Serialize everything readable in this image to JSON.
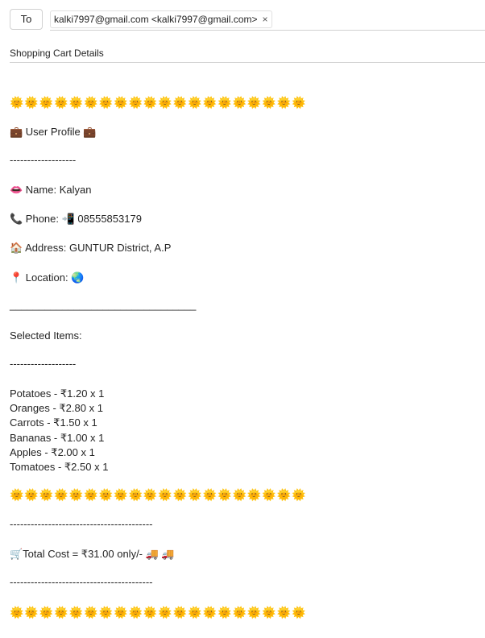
{
  "header": {
    "to_label": "To",
    "recipient": "kalki7997@gmail.com <kalki7997@gmail.com>",
    "remove_icon": "×",
    "subject": "Shopping Cart Details"
  },
  "body": {
    "sun_row": "🌞🌞🌞🌞🌞🌞🌞🌞🌞🌞🌞🌞🌞🌞🌞🌞🌞🌞🌞🌞",
    "profile_heading": "💼 User Profile 💼",
    "dash_short": "-------------------",
    "name_line": "👄 Name: Kalyan",
    "phone_line": "📞 Phone: 📲 08555853179",
    "address_line": "🏠 Address: GUNTUR District, A.P",
    "location_line": "📍 Location: 🌏",
    "underline_rule": "________________________________",
    "items_heading": "Selected Items:",
    "items": [
      "Potatoes - ₹1.20 x 1",
      "Oranges - ₹2.80 x 1",
      "Carrots - ₹1.50 x 1",
      "Bananas - ₹1.00 x 1",
      "Apples - ₹2.00 x 1",
      "Tomatoes - ₹2.50 x 1"
    ],
    "dash_long": "-----------------------------------------",
    "total_line": "🛒Total Cost = ₹31.00 only/-  🚚 🚚"
  }
}
